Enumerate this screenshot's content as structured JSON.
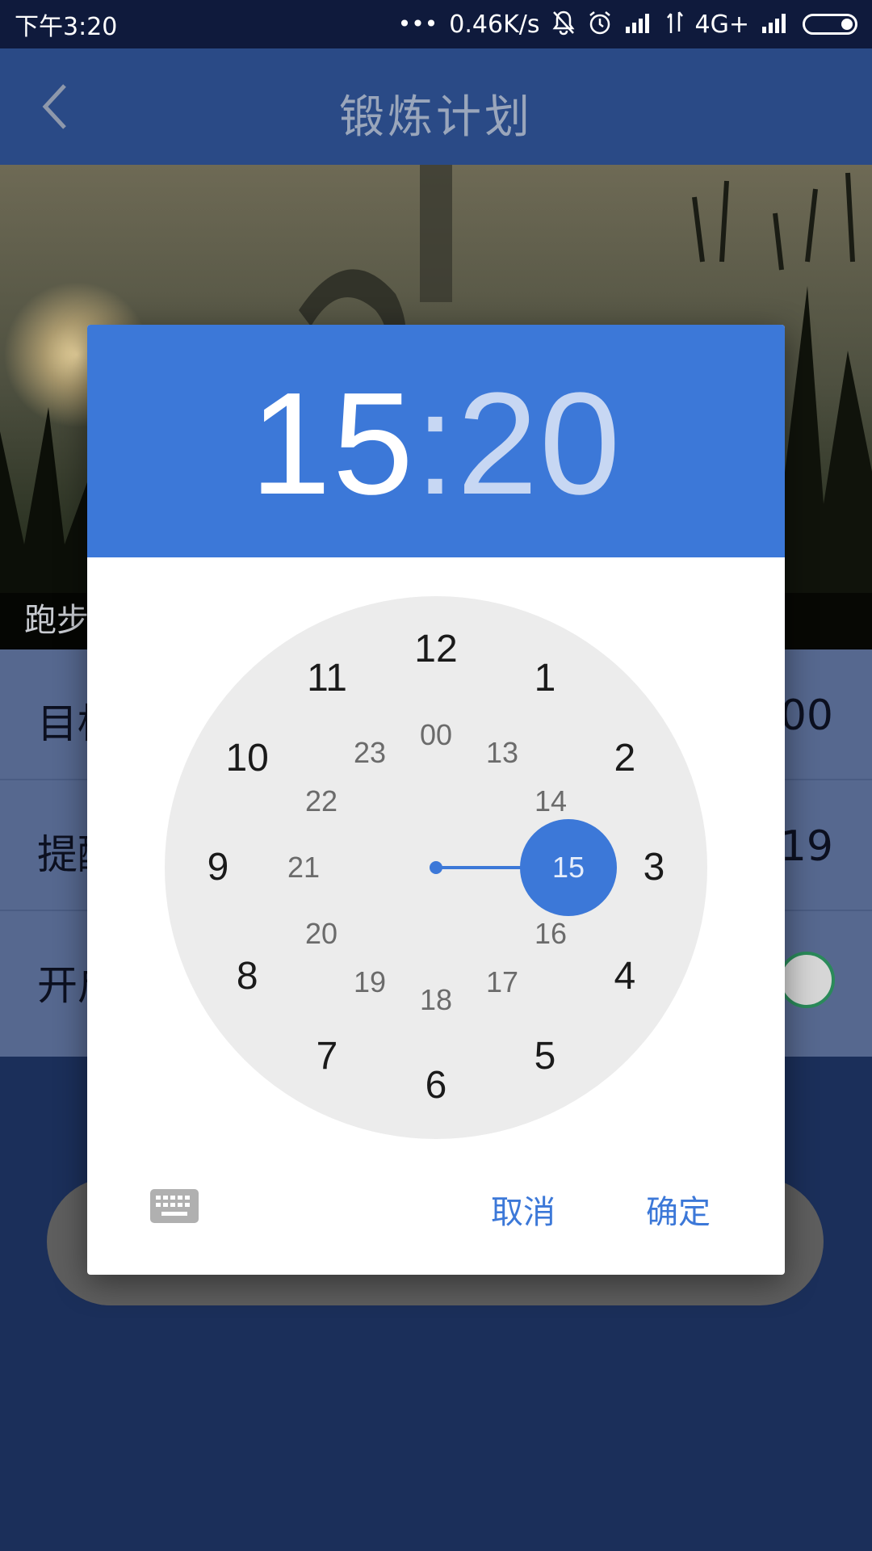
{
  "status_bar": {
    "time": "下午3:20",
    "dots": "•••",
    "net_speed": "0.46K/s",
    "network": "4G+"
  },
  "app_bar": {
    "title": "锻炼计划"
  },
  "hero": {
    "caption": "跑步"
  },
  "rows": [
    {
      "label": "目标",
      "value": "00"
    },
    {
      "label": "提醒",
      "value": "19"
    },
    {
      "label": "开启",
      "value": ""
    }
  ],
  "dialog": {
    "hour": "15",
    "colon": ":",
    "minute": "20",
    "outer_numbers": [
      "12",
      "1",
      "2",
      "3",
      "4",
      "5",
      "6",
      "7",
      "8",
      "9",
      "10",
      "11"
    ],
    "inner_numbers": [
      "00",
      "13",
      "14",
      "15",
      "16",
      "17",
      "18",
      "19",
      "20",
      "21",
      "22",
      "23"
    ],
    "selected": "15",
    "cancel_label": "取消",
    "ok_label": "确定"
  },
  "colors": {
    "accent": "#3c78d8",
    "app_bar": "#2a4a86",
    "status_bar": "#0f1a3c"
  }
}
